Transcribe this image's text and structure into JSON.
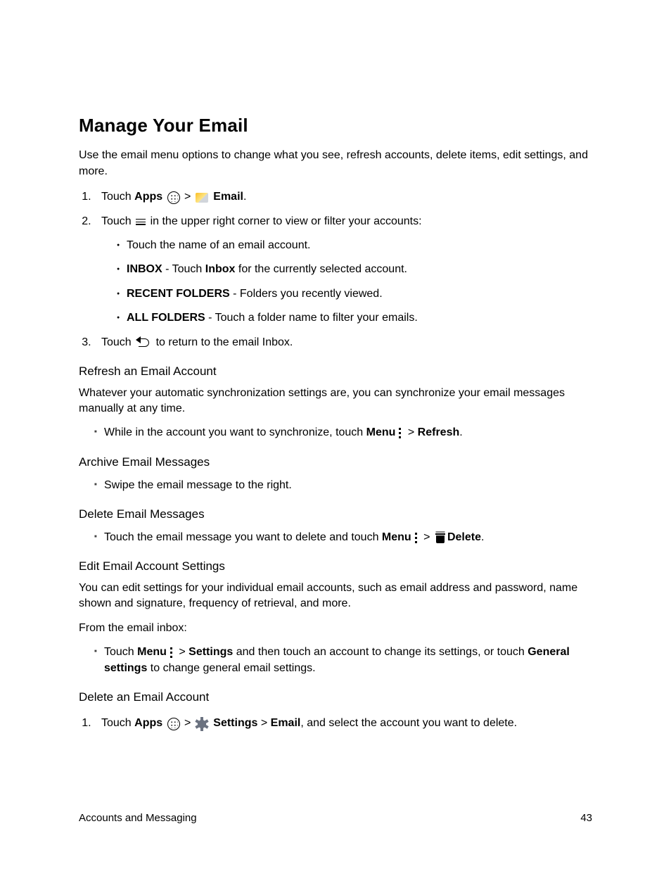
{
  "title": "Manage Your Email",
  "intro": "Use the email menu options to change what you see, refresh accounts, delete items, edit settings, and more.",
  "steps": {
    "s1": {
      "a": "Touch ",
      "apps": "Apps",
      "sep": " > ",
      "email": "Email",
      "dot": "."
    },
    "s2": {
      "a": "Touch ",
      "b": " in the upper right corner to view or filter your accounts:",
      "sub1": "Touch the name of an email account.",
      "sub2": {
        "bold": "INBOX",
        "mid": " - Touch ",
        "bold2": "Inbox",
        "rest": " for the currently selected account."
      },
      "sub3": {
        "bold": "RECENT FOLDERS",
        "rest": " - Folders you recently viewed."
      },
      "sub4": {
        "bold": "ALL FOLDERS",
        "rest": " - Touch a folder name to filter your emails."
      }
    },
    "s3": {
      "a": "Touch ",
      "b": " to return to the email Inbox."
    }
  },
  "refresh": {
    "h": "Refresh an Email Account",
    "p": "Whatever your automatic synchronization settings are, you can synchronize your email messages manually at any time.",
    "li": {
      "a": "While in the account you want to synchronize, touch ",
      "menu": "Menu",
      "sep": " > ",
      "refresh": "Refresh",
      "dot": "."
    }
  },
  "archive": {
    "h": "Archive Email Messages",
    "li": "Swipe the email message to the right."
  },
  "delete": {
    "h": "Delete Email Messages",
    "li": {
      "a": "Touch the email message you want to delete and touch ",
      "menu": "Menu",
      "sep": " > ",
      "del": "Delete",
      "dot": "."
    }
  },
  "edit": {
    "h": "Edit Email Account Settings",
    "p": "You can edit settings for your individual email accounts, such as email address and password, name shown and signature, frequency of retrieval, and more.",
    "p2": "From the email inbox:",
    "li": {
      "a": "Touch ",
      "menu": "Menu",
      "sep": " > ",
      "settings": "Settings",
      "mid": " and then touch an account to change its settings, or touch ",
      "general": "General settings",
      "rest": " to change general email settings."
    }
  },
  "delacct": {
    "h": "Delete an Email Account",
    "li": {
      "a": "Touch ",
      "apps": "Apps",
      "sep1": " > ",
      "settings": "Settings",
      "sep2": " > ",
      "email": "Email",
      "rest": ", and select the account you want to delete."
    }
  },
  "footer": {
    "left": "Accounts and Messaging",
    "right": "43"
  }
}
